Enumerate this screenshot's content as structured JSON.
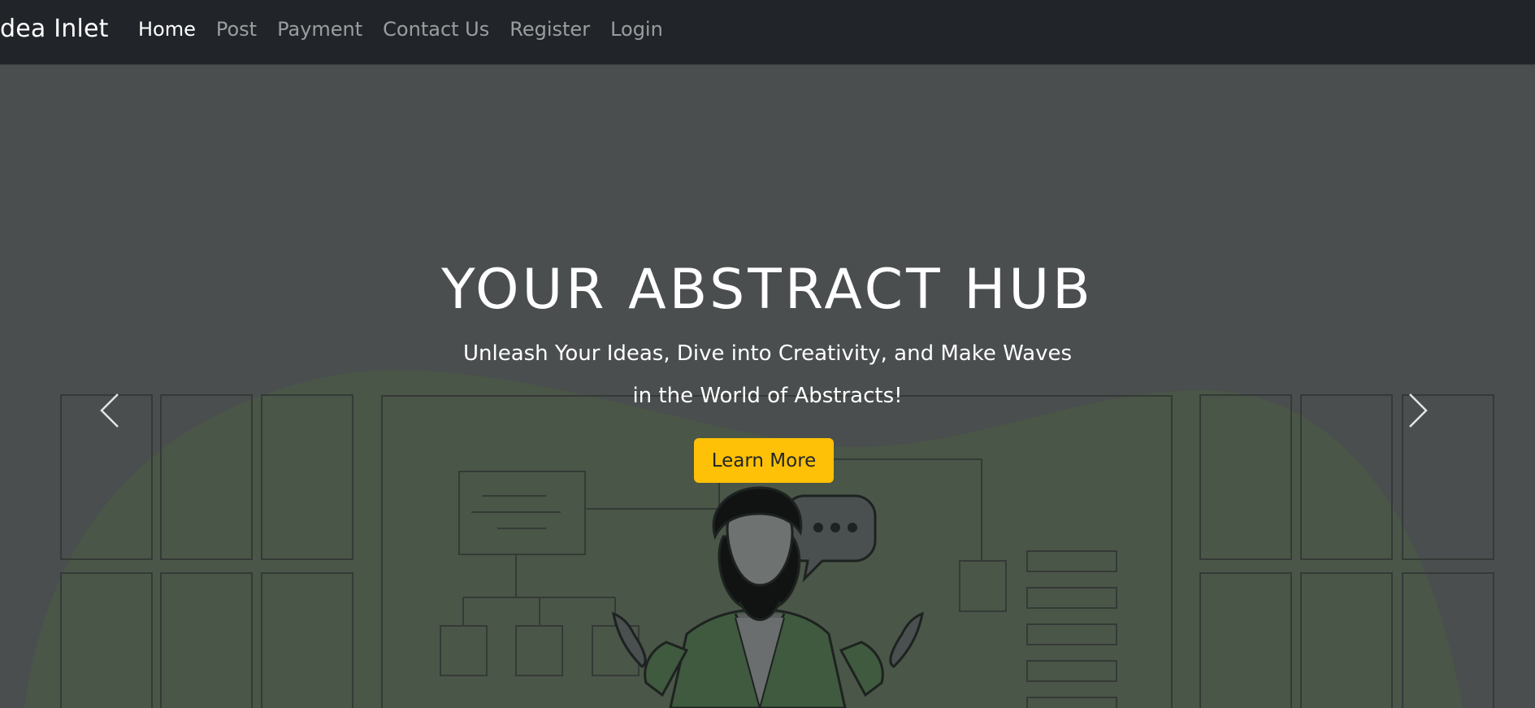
{
  "navbar": {
    "brand": "dea Inlet",
    "links": [
      {
        "label": "Home",
        "active": true
      },
      {
        "label": "Post"
      },
      {
        "label": "Payment"
      },
      {
        "label": "Contact Us"
      },
      {
        "label": "Register"
      },
      {
        "label": "Login"
      }
    ]
  },
  "hero": {
    "headline": "YOUR ABSTRACT HUB",
    "subtitle_line1": "Unleash Your Ideas, Dive into Creativity, and Make Waves",
    "subtitle_line2": "in the World of Abstracts!",
    "cta_label": "Learn More",
    "controls": {
      "prev_icon": "chevron-left-icon",
      "next_icon": "chevron-right-icon"
    }
  },
  "colors": {
    "navbar_bg": "#212529",
    "hero_bg": "#4a4e4f",
    "cta_bg": "#ffc107",
    "blob_green": "#4a5647"
  }
}
